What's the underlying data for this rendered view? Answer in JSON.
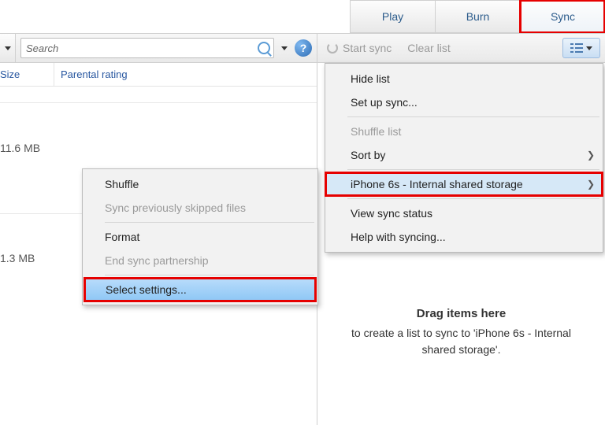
{
  "tabs": {
    "play": "Play",
    "burn": "Burn",
    "sync": "Sync"
  },
  "search": {
    "placeholder": "Search"
  },
  "sync_toolbar": {
    "start": "Start sync",
    "clear": "Clear list"
  },
  "columns": {
    "size": "Size",
    "parental": "Parental rating"
  },
  "rows": {
    "size1": "11.6 MB",
    "size2": "1.3 MB"
  },
  "sync_menu": {
    "hide": "Hide list",
    "setup": "Set up sync...",
    "shuffle": "Shuffle list",
    "sort": "Sort by",
    "device": "iPhone 6s - Internal shared storage",
    "status": "View sync status",
    "help": "Help with syncing..."
  },
  "ctx_menu": {
    "shuffle": "Shuffle",
    "skipped": "Sync previously skipped files",
    "format": "Format",
    "endpart": "End sync partnership",
    "settings": "Select settings..."
  },
  "drop": {
    "title": "Drag items here",
    "sub": "to create a list to sync to 'iPhone 6s - Internal shared storage'."
  }
}
